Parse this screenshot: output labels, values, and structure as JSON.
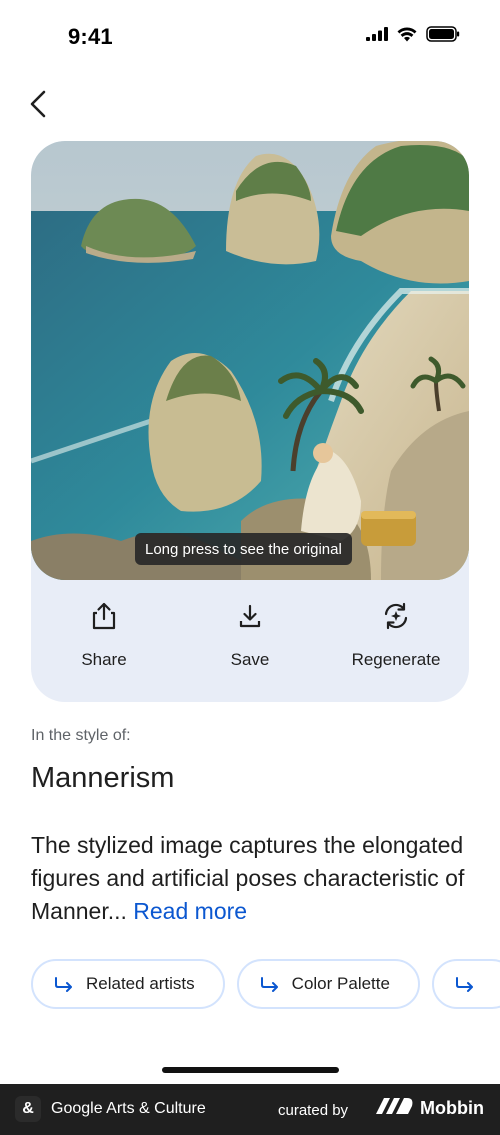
{
  "status_bar": {
    "time": "9:41",
    "icons": [
      "signal-icon",
      "wifi-icon",
      "battery-icon"
    ]
  },
  "nav": {
    "back_icon": "chevron-left-icon"
  },
  "preview": {
    "toast_text": "Long press to see the original"
  },
  "actions": [
    {
      "label": "Share",
      "icon": "share-icon"
    },
    {
      "label": "Save",
      "icon": "download-icon"
    },
    {
      "label": "Regenerate",
      "icon": "regenerate-icon"
    }
  ],
  "style": {
    "caption": "In the style of:",
    "name": "Mannerism",
    "description": "The stylized image captures the elongated figures and artificial poses characteristic of Manner...",
    "read_more": "Read more"
  },
  "chips": [
    {
      "label": "Related artists",
      "icon": "forward-arrow-icon"
    },
    {
      "label": "Color Palette",
      "icon": "forward-arrow-icon"
    },
    {
      "label": "",
      "icon": "forward-arrow-icon"
    }
  ],
  "footer": {
    "app_name": "Google Arts & Culture",
    "curated_by": "curated by",
    "brand": "Mobbin"
  },
  "colors": {
    "card_background": "#e8edf7",
    "accent_link": "#0b57d0",
    "chip_border": "#d3e3fd",
    "footer_background": "#1f1f1f"
  }
}
